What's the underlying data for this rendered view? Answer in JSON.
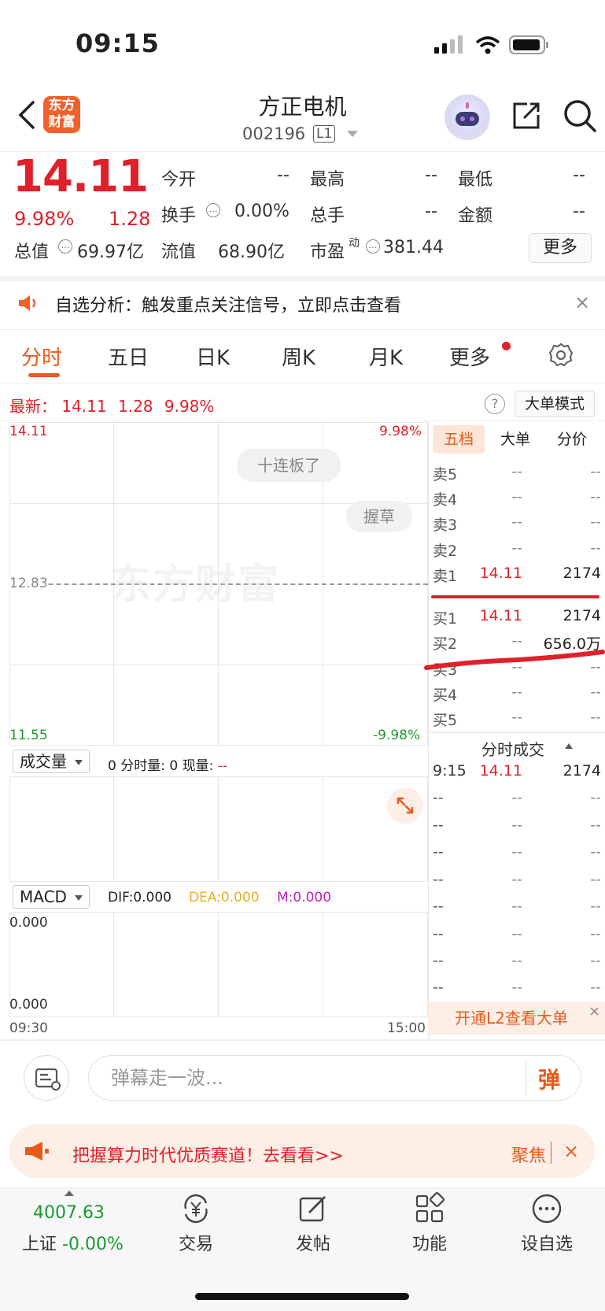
{
  "status_bar": {
    "time": "09:15"
  },
  "header": {
    "logo_line1": "东方",
    "logo_line2": "财富",
    "name": "方正电机",
    "code": "002196",
    "level": "L1"
  },
  "quote": {
    "price": "14.11",
    "pct": "9.98%",
    "change": "1.28",
    "fields": [
      {
        "label": "今开",
        "value": "--"
      },
      {
        "label": "最高",
        "value": "--"
      },
      {
        "label": "最低",
        "value": "--"
      },
      {
        "label": "换手",
        "value": "0.00%"
      },
      {
        "label": "总手",
        "value": "--"
      },
      {
        "label": "金额",
        "value": "--"
      },
      {
        "label": "总值",
        "value": "69.97亿"
      },
      {
        "label": "流值",
        "value": "68.90亿"
      },
      {
        "label": "市盈",
        "value": "381.44"
      }
    ],
    "pe_sup": "动",
    "more_label": "更多"
  },
  "alert": {
    "text": "自选分析：触发重点关注信号，立即点击查看",
    "close": "×"
  },
  "tabs": [
    "分时",
    "五日",
    "日K",
    "周K",
    "月K",
    "更多"
  ],
  "latest": {
    "label": "最新：",
    "price": "14.11",
    "change": "1.28",
    "pct": "9.98%",
    "help": "?",
    "mode": "大单模式"
  },
  "chart": {
    "y_top": "14.11",
    "y_mid": "12.83",
    "y_bottom": "11.55",
    "pct_top": "9.98%",
    "pct_bottom": "-9.98%",
    "chip1": "十连板了",
    "chip2": "握草",
    "watermark": "东方财富",
    "volume_selector": "成交量",
    "volume_info_prefix": "0 分时量: 0 现量: ",
    "volume_info_value": "--",
    "macd_selector": "MACD",
    "dif": "DIF:0.000",
    "dea": "DEA:0.000",
    "m": "M:0.000",
    "macd_top": "0.000",
    "macd_bottom": "0.000",
    "time_start": "09:30",
    "time_end": "15:00"
  },
  "order_book": {
    "tabs": [
      "五档",
      "大单",
      "分价"
    ],
    "asks": [
      {
        "label": "卖5",
        "price": "--",
        "vol": "--"
      },
      {
        "label": "卖4",
        "price": "--",
        "vol": "--"
      },
      {
        "label": "卖3",
        "price": "--",
        "vol": "--"
      },
      {
        "label": "卖2",
        "price": "--",
        "vol": "--"
      },
      {
        "label": "卖1",
        "price": "14.11",
        "vol": "2174"
      }
    ],
    "bids": [
      {
        "label": "买1",
        "price": "14.11",
        "vol": "2174"
      },
      {
        "label": "买2",
        "price": "--",
        "vol": "656.0万"
      },
      {
        "label": "买3",
        "price": "--",
        "vol": "--"
      },
      {
        "label": "买4",
        "price": "--",
        "vol": "--"
      },
      {
        "label": "买5",
        "price": "--",
        "vol": "--"
      }
    ],
    "ticks_title": "分时成交",
    "ticks": [
      {
        "time": "9:15",
        "price": "14.11",
        "vol": "2174"
      },
      {
        "time": "--",
        "price": "--",
        "vol": "--"
      },
      {
        "time": "--",
        "price": "--",
        "vol": "--"
      },
      {
        "time": "--",
        "price": "--",
        "vol": "--"
      },
      {
        "time": "--",
        "price": "--",
        "vol": "--"
      },
      {
        "time": "--",
        "price": "--",
        "vol": "--"
      },
      {
        "time": "--",
        "price": "--",
        "vol": "--"
      },
      {
        "time": "--",
        "price": "--",
        "vol": "--"
      },
      {
        "time": "--",
        "price": "--",
        "vol": "--"
      }
    ],
    "l2_banner": "开通L2查看大单"
  },
  "danmu": {
    "placeholder": "弹幕走一波...",
    "send": "弹"
  },
  "promo": {
    "text": "把握算力时代优质赛道！去看看>>",
    "tag": "聚焦",
    "close": "×"
  },
  "bottom_nav": {
    "index_value": "4007.63",
    "index_name": "上证",
    "index_change": "-0.00%",
    "items": [
      "交易",
      "发帖",
      "功能",
      "设自选"
    ]
  },
  "colors": {
    "up": "#e0202a",
    "down": "#1a9a2e",
    "accent": "#e85a1c"
  }
}
